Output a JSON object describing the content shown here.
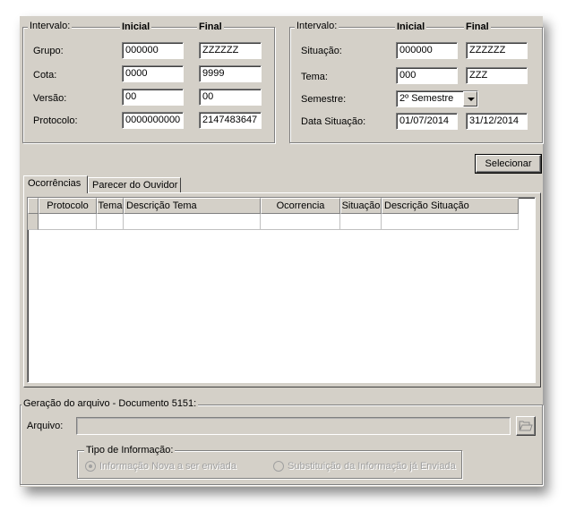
{
  "left_group": {
    "legend": "Intervalo:",
    "col_inicial": "Inicial",
    "col_final": "Final",
    "rows": [
      {
        "label": "Grupo:",
        "inicial": "000000",
        "final": "ZZZZZZ"
      },
      {
        "label": "Cota:",
        "inicial": "0000",
        "final": "9999"
      },
      {
        "label": "Versão:",
        "inicial": "00",
        "final": "00"
      },
      {
        "label": "Protocolo:",
        "inicial": "0000000000",
        "final": "2147483647"
      }
    ]
  },
  "right_group": {
    "legend": "Intervalo:",
    "col_inicial": "Inicial",
    "col_final": "Final",
    "situacao": {
      "label": "Situação:",
      "inicial": "000000",
      "final": "ZZZZZZ"
    },
    "tema": {
      "label": "Tema:",
      "inicial": "000",
      "final": "ZZZ"
    },
    "semestre": {
      "label": "Semestre:",
      "value": "2º Semestre"
    },
    "data_situacao": {
      "label": "Data Situação:",
      "inicial": "01/07/2014",
      "final": "31/12/2014"
    }
  },
  "select_button": "Selecionar",
  "tabs": [
    "Ocorrências",
    "Parecer do Ouvidor"
  ],
  "grid": {
    "columns": [
      "Protocolo",
      "Tema",
      "Descrição Tema",
      "Ocorrencia",
      "Situação",
      "Descrição Situação"
    ]
  },
  "file_group": {
    "legend": "Geração do arquivo - Documento 5151:",
    "arquivo_label": "Arquivo:",
    "arquivo_value": "",
    "folder_icon": "open-folder-icon",
    "tipo": {
      "legend": "Tipo de Informação:",
      "options": [
        "Informação Nova a ser enviada",
        "Substituição da Informação já Enviada"
      ],
      "selected": 0
    }
  }
}
